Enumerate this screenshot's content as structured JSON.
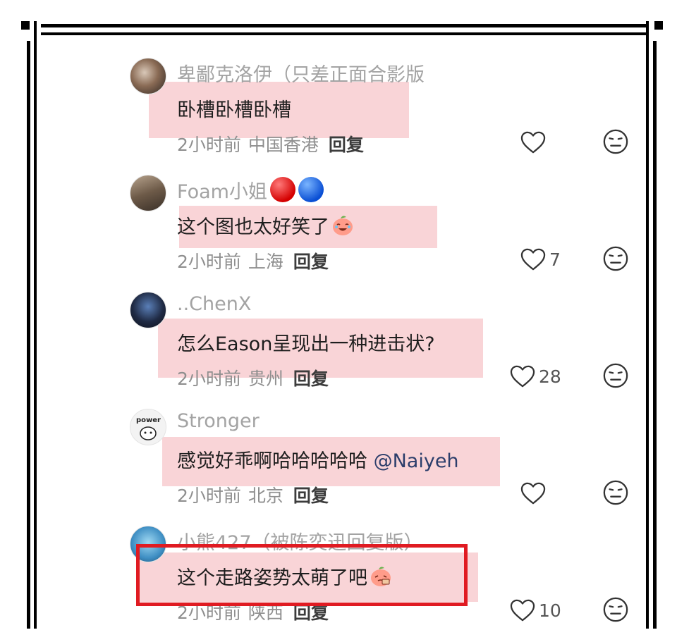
{
  "comments": [
    {
      "username": "卑鄙克洛伊（只差正面合影版",
      "text": "卧槽卧槽卧槽",
      "time": "2小时前",
      "location": "中国香港",
      "reply_label": "回复",
      "likes": ""
    },
    {
      "username": "Foam小姐",
      "username_badges": [
        "red-circle-icon",
        "blue-circle-icon"
      ],
      "text": "这个图也太好笑了",
      "text_emoji": "laughing-crying-peach-emoji",
      "time": "2小时前",
      "location": "上海",
      "reply_label": "回复",
      "likes": "7"
    },
    {
      "username": "..ChenX",
      "text": "怎么Eason呈现出一种进击状?",
      "time": "2小时前",
      "location": "贵州",
      "reply_label": "回复",
      "likes": "28"
    },
    {
      "username": "Stronger",
      "text": "感觉好乖啊哈哈哈哈哈 ",
      "mention": "@Naiyeh",
      "time": "2小时前",
      "location": "北京",
      "reply_label": "回复",
      "likes": ""
    },
    {
      "username": "小熊427（被陈奕迅回复版）",
      "text": "这个走路姿势太萌了吧",
      "text_emoji": "shy-peach-emoji",
      "time": "2小时前",
      "location": "陕西",
      "reply_label": "回复",
      "likes": "10"
    }
  ],
  "colors": {
    "highlight": "#f8cfd3",
    "annotation_box": "#e01b22",
    "username": "#a3a3a3",
    "meta": "#8f8f8f"
  }
}
